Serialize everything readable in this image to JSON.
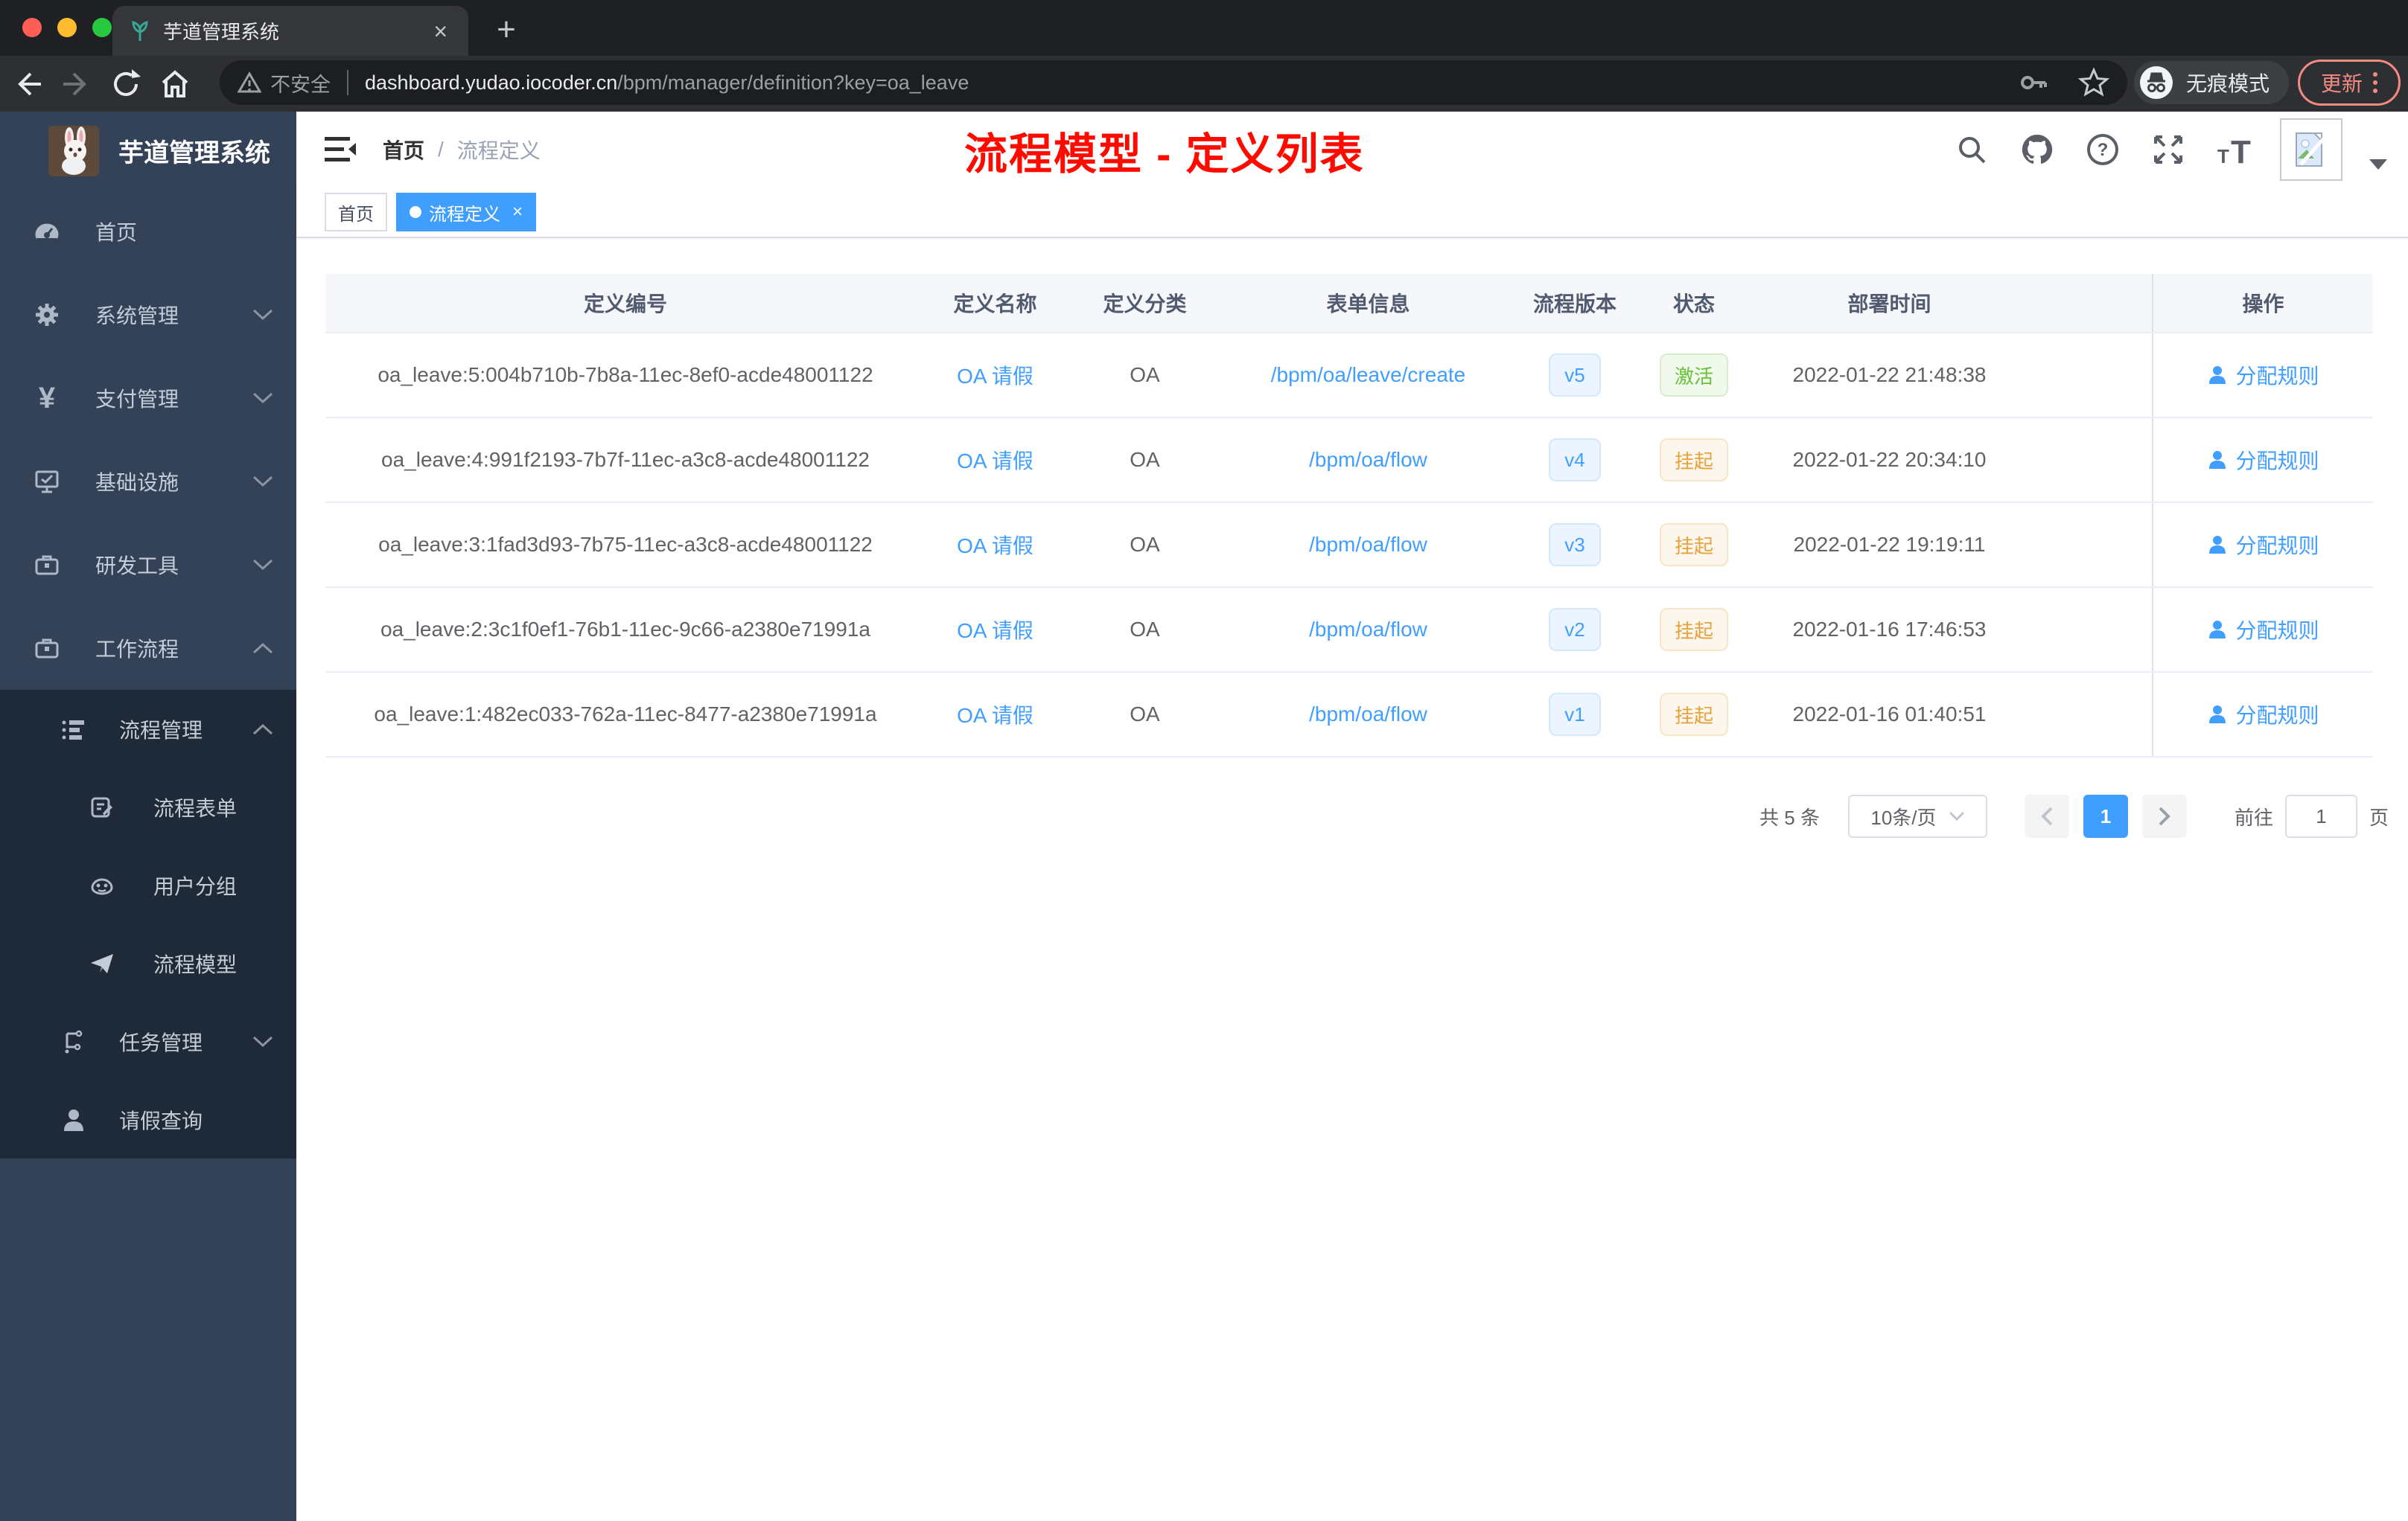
{
  "browser": {
    "tab_title": "芋道管理系统",
    "tab_close": "×",
    "new_tab": "+",
    "security_label": "不安全",
    "url_host": "dashboard.yudao.iocoder.cn",
    "url_path": "/bpm/manager/definition?key=oa_leave",
    "incognito_label": "无痕模式",
    "update_label": "更新"
  },
  "sidebar": {
    "logo_title": "芋道管理系统",
    "items": [
      {
        "label": "首页",
        "icon": "dashboard-icon"
      },
      {
        "label": "系统管理",
        "icon": "gear-icon"
      },
      {
        "label": "支付管理",
        "icon": "yen-icon"
      },
      {
        "label": "基础设施",
        "icon": "infrastructure-icon"
      },
      {
        "label": "研发工具",
        "icon": "toolbox-icon"
      },
      {
        "label": "工作流程",
        "icon": "briefcase-icon"
      },
      {
        "label": "流程管理",
        "icon": "list-tree-icon"
      },
      {
        "label": "流程表单",
        "icon": "form-icon"
      },
      {
        "label": "用户分组",
        "icon": "user-group-icon"
      },
      {
        "label": "流程模型",
        "icon": "paper-plane-icon"
      },
      {
        "label": "任务管理",
        "icon": "task-tree-icon"
      },
      {
        "label": "请假查询",
        "icon": "person-icon"
      }
    ]
  },
  "header": {
    "breadcrumb": [
      "首页",
      "流程定义"
    ],
    "breadcrumb_separator": "/",
    "annotation": "流程模型 - 定义列表",
    "annotation_color": "#fe0000"
  },
  "tags": [
    {
      "label": "首页",
      "active": false
    },
    {
      "label": "流程定义",
      "active": true,
      "close": "×"
    }
  ],
  "table": {
    "columns": [
      "定义编号",
      "定义名称",
      "定义分类",
      "表单信息",
      "流程版本",
      "状态",
      "部署时间",
      "操作"
    ],
    "rows": [
      {
        "id": "oa_leave:5:004b710b-7b8a-11ec-8ef0-acde48001122",
        "name": "OA 请假",
        "category": "OA",
        "form": "/bpm/oa/leave/create",
        "version": "v5",
        "status": "激活",
        "status_type": "success",
        "deploy_time": "2022-01-22 21:48:38",
        "action": "分配规则"
      },
      {
        "id": "oa_leave:4:991f2193-7b7f-11ec-a3c8-acde48001122",
        "name": "OA 请假",
        "category": "OA",
        "form": "/bpm/oa/flow",
        "version": "v4",
        "status": "挂起",
        "status_type": "warning",
        "deploy_time": "2022-01-22 20:34:10",
        "action": "分配规则"
      },
      {
        "id": "oa_leave:3:1fad3d93-7b75-11ec-a3c8-acde48001122",
        "name": "OA 请假",
        "category": "OA",
        "form": "/bpm/oa/flow",
        "version": "v3",
        "status": "挂起",
        "status_type": "warning",
        "deploy_time": "2022-01-22 19:19:11",
        "action": "分配规则"
      },
      {
        "id": "oa_leave:2:3c1f0ef1-76b1-11ec-9c66-a2380e71991a",
        "name": "OA 请假",
        "category": "OA",
        "form": "/bpm/oa/flow",
        "version": "v2",
        "status": "挂起",
        "status_type": "warning",
        "deploy_time": "2022-01-16 17:46:53",
        "action": "分配规则"
      },
      {
        "id": "oa_leave:1:482ec033-762a-11ec-8477-a2380e71991a",
        "name": "OA 请假",
        "category": "OA",
        "form": "/bpm/oa/flow",
        "version": "v1",
        "status": "挂起",
        "status_type": "warning",
        "deploy_time": "2022-01-16 01:40:51",
        "action": "分配规则"
      }
    ]
  },
  "pagination": {
    "total": "共 5 条",
    "page_size": "10条/页",
    "current_page": "1",
    "goto_label": "前往",
    "goto_value": "1",
    "page_unit": "页"
  },
  "colors": {
    "primary": "#409eff",
    "success": "#67c23a",
    "warning": "#e6a23c",
    "sidebar_bg": "#344258",
    "submenu_bg": "#1f2a38"
  }
}
